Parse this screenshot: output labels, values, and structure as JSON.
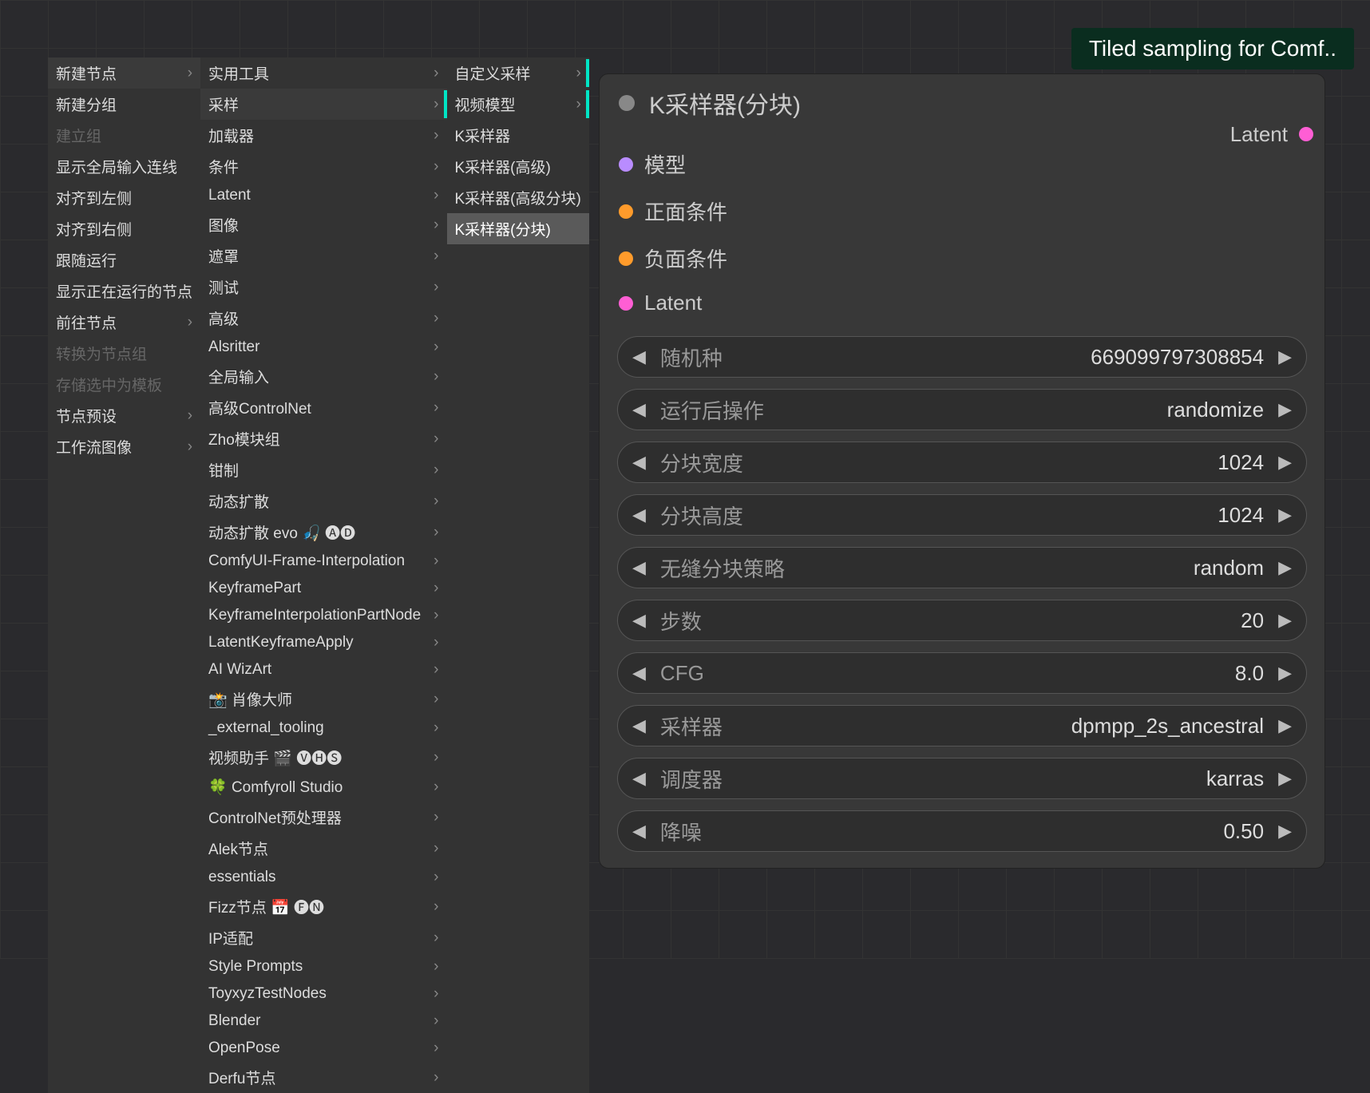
{
  "tooltip": "Tiled sampling for Comf..",
  "menu": {
    "col1": [
      {
        "label": "新建节点",
        "arrow": true,
        "active": true
      },
      {
        "label": "新建分组",
        "arrow": false
      },
      {
        "label": "建立组",
        "arrow": false,
        "disabled": true
      },
      {
        "label": "显示全局输入连线",
        "arrow": false
      },
      {
        "label": "对齐到左侧",
        "arrow": false
      },
      {
        "label": "对齐到右侧",
        "arrow": false
      },
      {
        "label": "跟随运行",
        "arrow": false
      },
      {
        "label": "显示正在运行的节点",
        "arrow": false
      },
      {
        "label": "前往节点",
        "arrow": true
      },
      {
        "label": "转换为节点组",
        "arrow": false,
        "disabled": true
      },
      {
        "label": "存储选中为模板",
        "arrow": false,
        "disabled": true
      },
      {
        "label": "节点预设",
        "arrow": true
      },
      {
        "label": "工作流图像",
        "arrow": true
      }
    ],
    "col2": [
      {
        "label": "实用工具",
        "arrow": true
      },
      {
        "label": "采样",
        "arrow": true,
        "active": true
      },
      {
        "label": "加载器",
        "arrow": true
      },
      {
        "label": "条件",
        "arrow": true
      },
      {
        "label": "Latent",
        "arrow": true
      },
      {
        "label": "图像",
        "arrow": true
      },
      {
        "label": "遮罩",
        "arrow": true
      },
      {
        "label": "测试",
        "arrow": true
      },
      {
        "label": "高级",
        "arrow": true
      },
      {
        "label": "Alsritter",
        "arrow": true
      },
      {
        "label": "全局输入",
        "arrow": true
      },
      {
        "label": "高级ControlNet",
        "arrow": true
      },
      {
        "label": "Zho模块组",
        "arrow": true
      },
      {
        "label": "钳制",
        "arrow": true
      },
      {
        "label": "动态扩散",
        "arrow": true
      },
      {
        "label": "动态扩散 evo 🎣 🅐🅓",
        "arrow": true
      },
      {
        "label": "ComfyUI-Frame-Interpolation",
        "arrow": true
      },
      {
        "label": "KeyframePart",
        "arrow": true
      },
      {
        "label": "KeyframeInterpolationPartNode",
        "arrow": true
      },
      {
        "label": "LatentKeyframeApply",
        "arrow": true
      },
      {
        "label": "AI WizArt",
        "arrow": true
      },
      {
        "label": "📸 肖像大师",
        "arrow": true
      },
      {
        "label": "_external_tooling",
        "arrow": true
      },
      {
        "label": "视频助手 🎬 🅥🅗🅢",
        "arrow": true
      },
      {
        "label": "🍀 Comfyroll Studio",
        "arrow": true
      },
      {
        "label": "ControlNet预处理器",
        "arrow": true
      },
      {
        "label": "Alek节点",
        "arrow": true
      },
      {
        "label": "essentials",
        "arrow": true
      },
      {
        "label": "Fizz节点 📅 🅕🅝",
        "arrow": true
      },
      {
        "label": "IP适配",
        "arrow": true
      },
      {
        "label": "Style Prompts",
        "arrow": true
      },
      {
        "label": "ToyxyzTestNodes",
        "arrow": true
      },
      {
        "label": "Blender",
        "arrow": true
      },
      {
        "label": "OpenPose",
        "arrow": true
      },
      {
        "label": "Derfu节点",
        "arrow": true
      }
    ],
    "col3": [
      {
        "label": "自定义采样",
        "arrow": true,
        "tick": true
      },
      {
        "label": "视频模型",
        "arrow": true,
        "tick": true
      },
      {
        "label": "K采样器",
        "arrow": false
      },
      {
        "label": "K采样器(高级)",
        "arrow": false
      },
      {
        "label": "K采样器(高级分块)",
        "arrow": false
      },
      {
        "label": "K采样器(分块)",
        "arrow": false,
        "highlighted": true
      }
    ]
  },
  "node": {
    "title": "K采样器(分块)",
    "inputs": [
      {
        "label": "模型",
        "color": "dot-purple"
      },
      {
        "label": "正面条件",
        "color": "dot-orange"
      },
      {
        "label": "负面条件",
        "color": "dot-orange"
      },
      {
        "label": "Latent",
        "color": "dot-pink"
      }
    ],
    "output": {
      "label": "Latent",
      "color": "dot-pink"
    },
    "widgets": [
      {
        "label": "随机种",
        "value": "669099797308854"
      },
      {
        "label": "运行后操作",
        "value": "randomize"
      },
      {
        "label": "分块宽度",
        "value": "1024"
      },
      {
        "label": "分块高度",
        "value": "1024"
      },
      {
        "label": "无缝分块策略",
        "value": "random"
      },
      {
        "label": "步数",
        "value": "20"
      },
      {
        "label": "CFG",
        "value": "8.0"
      },
      {
        "label": "采样器",
        "value": "dpmpp_2s_ancestral"
      },
      {
        "label": "调度器",
        "value": "karras"
      },
      {
        "label": "降噪",
        "value": "0.50"
      }
    ]
  }
}
